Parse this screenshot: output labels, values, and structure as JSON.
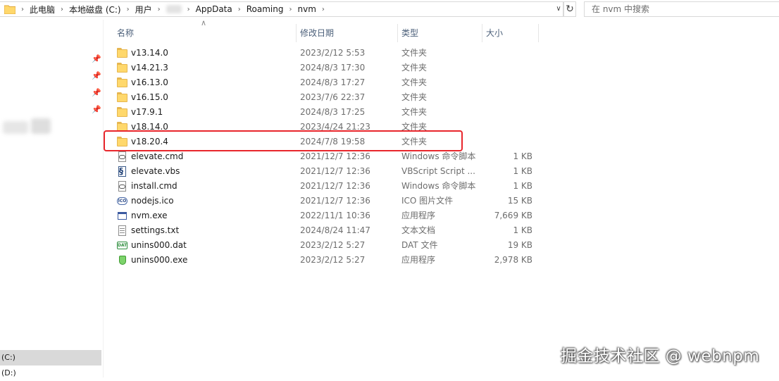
{
  "address_bar": {
    "crumbs": [
      "此电脑",
      "本地磁盘 (C:)",
      "用户",
      "AppData",
      "Roaming",
      "nvm"
    ],
    "search_placeholder": "在 nvm 中搜索"
  },
  "nav_pane": {
    "drives": [
      "(C:)",
      "(D:)"
    ]
  },
  "columns": {
    "name": "名称",
    "date": "修改日期",
    "type": "类型",
    "size": "大小"
  },
  "files": [
    {
      "name": "v13.14.0",
      "date": "2023/2/12 5:53",
      "type": "文件夹",
      "size": "",
      "icon": "folder-icon"
    },
    {
      "name": "v14.21.3",
      "date": "2024/8/3 17:30",
      "type": "文件夹",
      "size": "",
      "icon": "folder-icon"
    },
    {
      "name": "v16.13.0",
      "date": "2024/8/3 17:27",
      "type": "文件夹",
      "size": "",
      "icon": "folder-icon"
    },
    {
      "name": "v16.15.0",
      "date": "2023/7/6 22:37",
      "type": "文件夹",
      "size": "",
      "icon": "folder-icon"
    },
    {
      "name": "v17.9.1",
      "date": "2024/8/3 17:25",
      "type": "文件夹",
      "size": "",
      "icon": "folder-icon"
    },
    {
      "name": "v18.14.0",
      "date": "2023/4/24 21:23",
      "type": "文件夹",
      "size": "",
      "icon": "folder-icon"
    },
    {
      "name": "v18.20.4",
      "date": "2024/7/8 19:58",
      "type": "文件夹",
      "size": "",
      "icon": "folder-icon"
    },
    {
      "name": "elevate.cmd",
      "date": "2021/12/7 12:36",
      "type": "Windows 命令脚本",
      "size": "1 KB",
      "icon": "cmd-file-icon"
    },
    {
      "name": "elevate.vbs",
      "date": "2021/12/7 12:36",
      "type": "VBScript Script ...",
      "size": "1 KB",
      "icon": "vbs-file-icon"
    },
    {
      "name": "install.cmd",
      "date": "2021/12/7 12:36",
      "type": "Windows 命令脚本",
      "size": "1 KB",
      "icon": "cmd-file-icon"
    },
    {
      "name": "nodejs.ico",
      "date": "2021/12/7 12:36",
      "type": "ICO 图片文件",
      "size": "15 KB",
      "icon": "ico-file-icon"
    },
    {
      "name": "nvm.exe",
      "date": "2022/11/1 10:36",
      "type": "应用程序",
      "size": "7,669 KB",
      "icon": "exe-file-icon"
    },
    {
      "name": "settings.txt",
      "date": "2024/8/24 11:47",
      "type": "文本文档",
      "size": "1 KB",
      "icon": "txt-file-icon"
    },
    {
      "name": "unins000.dat",
      "date": "2023/2/12 5:27",
      "type": "DAT 文件",
      "size": "19 KB",
      "icon": "dat-file-icon"
    },
    {
      "name": "unins000.exe",
      "date": "2023/2/12 5:27",
      "type": "应用程序",
      "size": "2,978 KB",
      "icon": "uninstaller-icon"
    }
  ],
  "highlighted_file": "v18.20.4",
  "highlight_color": "#e8262c",
  "watermark": "掘金技术社区 @ webnpm"
}
